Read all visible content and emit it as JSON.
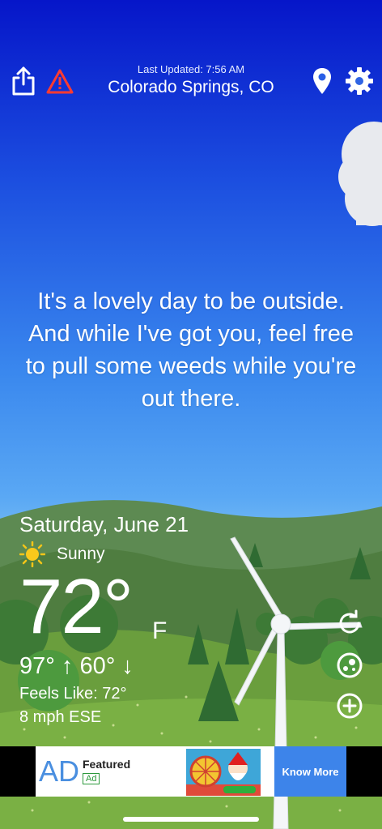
{
  "header": {
    "last_updated": "Last Updated: 7:56 AM",
    "location": "Colorado Springs, CO",
    "icons": [
      "share-icon",
      "alert-triangle-icon",
      "location-pin-icon",
      "gear-icon"
    ]
  },
  "message": "It's a lovely day to be outside. And while I've got you, feel free to pull some weeds while you're out there.",
  "weather": {
    "date": "Saturday, June 21",
    "condition": "Sunny",
    "condition_icon": "sun-icon",
    "temperature": "72°",
    "unit": "F",
    "high_low": "97° ↑  60° ↓",
    "feels_like": "Feels Like: 72°",
    "wind": "8 mph ESE"
  },
  "side_actions": [
    "refresh-icon",
    "radar-icon",
    "add-icon"
  ],
  "ad": {
    "logo": "AD",
    "title": "Featured",
    "badge": "Ad",
    "cta": "Know More"
  },
  "colors": {
    "sky_top": "#0616c9",
    "sky_bottom": "#6fb7f4",
    "hill": "#4a7a3a",
    "cta": "#3d84ea"
  }
}
